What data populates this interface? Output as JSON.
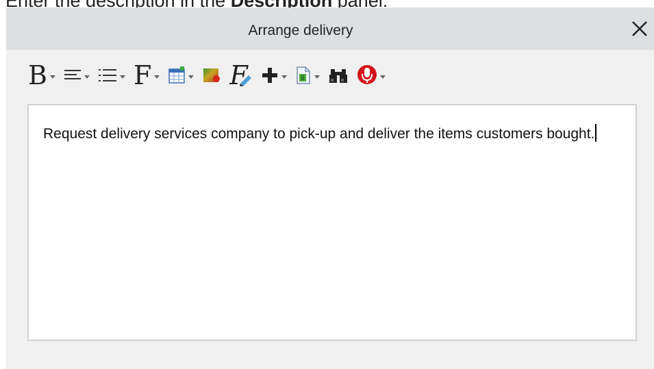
{
  "instruction": {
    "prefix": "Enter the description in the ",
    "bold": "Description",
    "suffix": " panel."
  },
  "panel": {
    "title": "Arrange delivery"
  },
  "toolbar": {
    "bold_glyph": "B",
    "font_glyph": "F",
    "formula_glyph": "F"
  },
  "editor": {
    "text": "Request delivery services company to pick-up and deliver the items customers bought."
  }
}
